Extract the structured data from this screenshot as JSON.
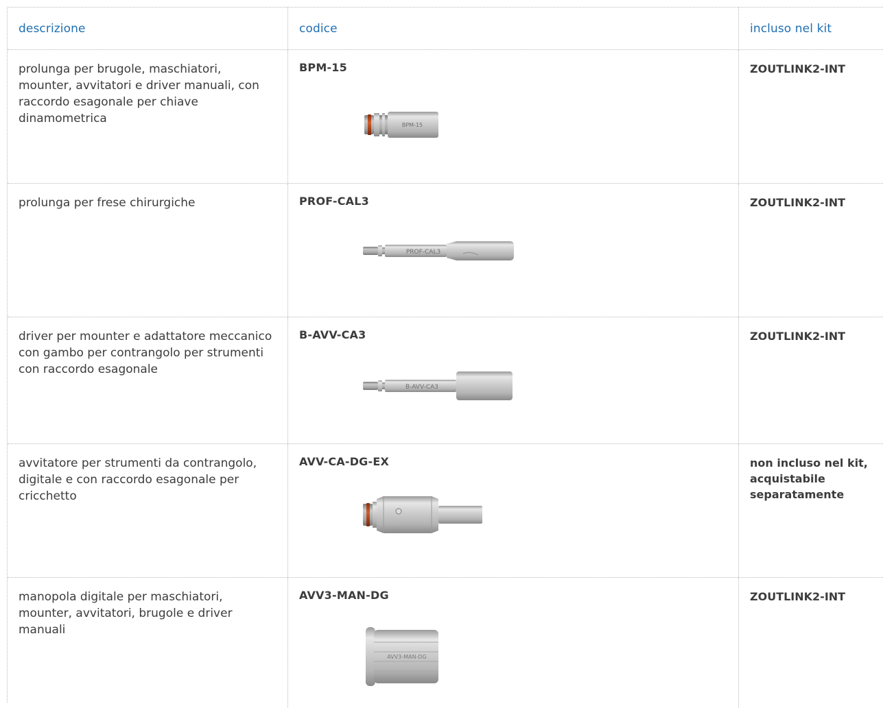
{
  "header": {
    "col_description": "descrizione",
    "col_code": "codice",
    "col_kit": "incluso nel kit"
  },
  "rows": [
    {
      "description": "prolunga per brugole, maschiatori, mounter, avvitatori e driver manuali, con raccordo esagonale per chiave dinamometrica",
      "code": "BPM-15",
      "kit": "ZOUTLINK2-INT",
      "image_label": "BPM-15"
    },
    {
      "description": "prolunga per frese chirurgiche",
      "code": "PROF-CAL3",
      "kit": "ZOUTLINK2-INT",
      "image_label": "PROF-CAL3"
    },
    {
      "description": "driver per mounter e adattatore meccanico con gambo per contrangolo per strumenti con raccordo esagonale",
      "code": "B-AVV-CA3",
      "kit": "ZOUTLINK2-INT",
      "image_label": "B-AVV-CA3"
    },
    {
      "description": "avvitatore per strumenti da contrangolo, digitale e con raccordo esagonale per cricchetto",
      "code": "AVV-CA-DG-EX",
      "kit": "non incluso nel kit, acquistabile separatamente",
      "image_label": ""
    },
    {
      "description": "manopola digitale per maschiatori, mounter, avvitatori, brugole e driver manuali",
      "code": "AVV3-MAN-DG",
      "kit": "ZOUTLINK2-INT",
      "image_label": "AVV3-MAN-DG"
    }
  ],
  "colors": {
    "header_text": "#1f6fb2",
    "body_text": "#3c3c3c",
    "grid_line": "#b9b9b9",
    "o_ring": "#b8481c"
  }
}
